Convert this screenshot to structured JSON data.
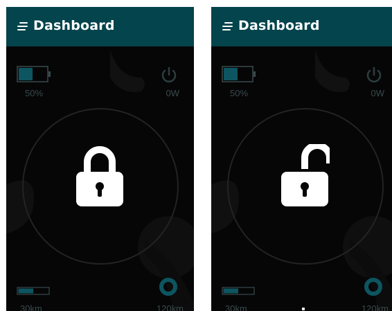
{
  "screens": [
    {
      "id": "locked",
      "header": {
        "title": "Dashboard"
      },
      "battery": {
        "level": 0.5,
        "label": "50%"
      },
      "power": {
        "label": "0W"
      },
      "lock": {
        "state": "locked",
        "icon": "lock-closed-icon"
      },
      "range": {
        "used_fraction": 0.5,
        "min_label": "30km",
        "max_label": "120km"
      }
    },
    {
      "id": "unlocked",
      "header": {
        "title": "Dashboard"
      },
      "battery": {
        "level": 0.5,
        "label": "50%"
      },
      "power": {
        "label": "0W"
      },
      "lock": {
        "state": "unlocked",
        "icon": "lock-open-icon"
      },
      "range": {
        "used_fraction": 0.5,
        "min_label": "30km",
        "max_label": "120km"
      }
    }
  ],
  "colors": {
    "header_bg": "#04444c",
    "screen_bg": "#060606",
    "accent_teal": "#0d5560",
    "muted_text": "#3a4a4c"
  }
}
